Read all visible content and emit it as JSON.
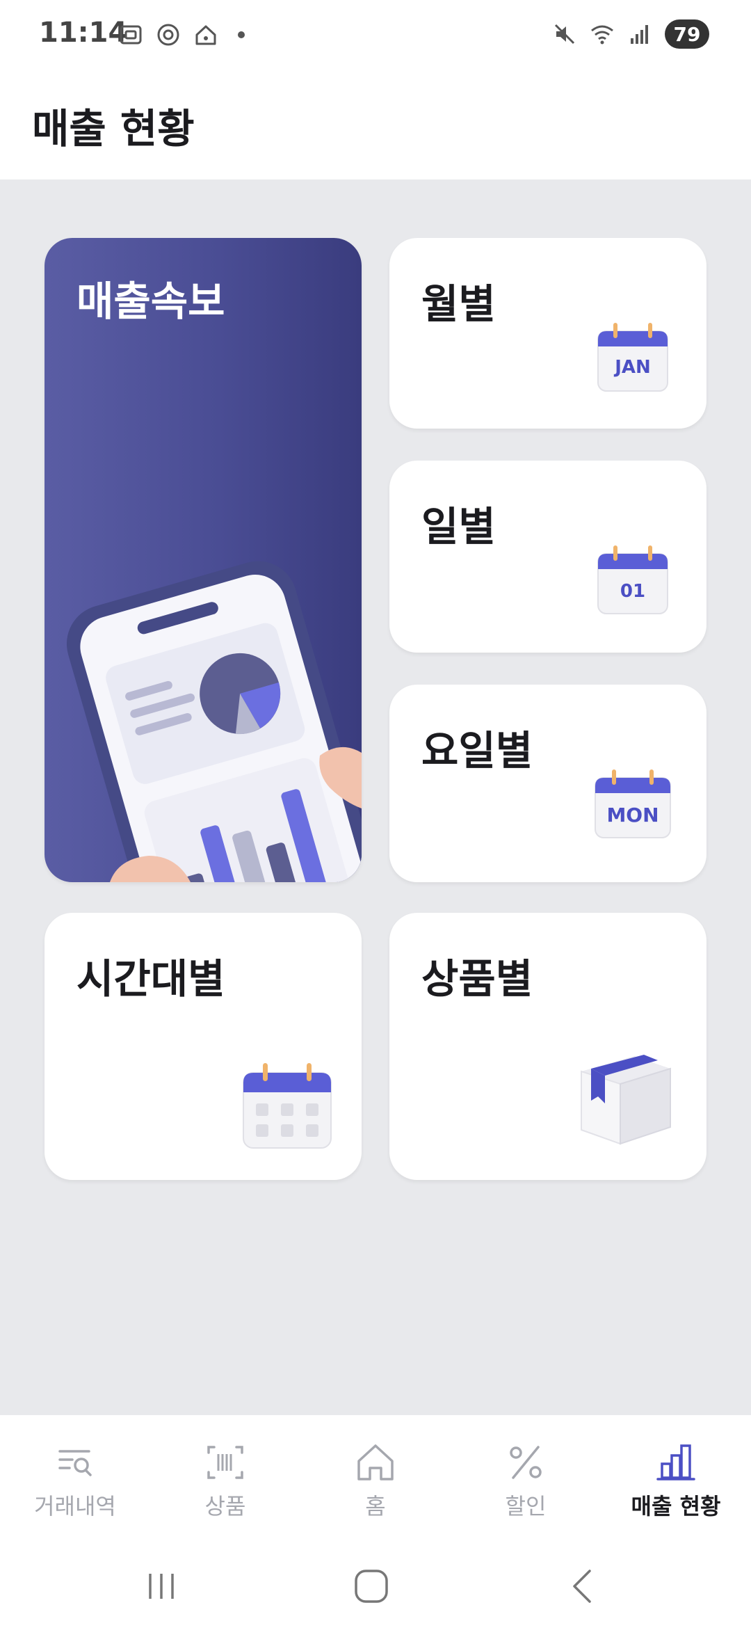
{
  "status_bar": {
    "time": "11:14",
    "battery": "79",
    "left_icons": [
      "screenshot-icon",
      "chrome-icon",
      "smart-home-icon",
      "notification-dot-icon"
    ],
    "right_icons": [
      "mute-icon",
      "wifi-icon",
      "signal-icon",
      "battery-icon"
    ]
  },
  "header": {
    "title": "매출 현황"
  },
  "cards": {
    "hero": {
      "label": "매출속보",
      "icon": "phone-chart-illustration"
    },
    "monthly": {
      "label": "월별",
      "icon_text": "JAN",
      "icon": "calendar-icon"
    },
    "daily": {
      "label": "일별",
      "icon_text": "01",
      "icon": "calendar-icon"
    },
    "weekday": {
      "label": "요일별",
      "icon_text": "MON",
      "icon": "calendar-icon"
    },
    "hourly": {
      "label": "시간대별",
      "icon": "calendar-grid-icon"
    },
    "product": {
      "label": "상품별",
      "icon": "box-icon"
    }
  },
  "bottom_nav": {
    "items": [
      {
        "label": "거래내역",
        "icon": "list-search-icon",
        "active": false
      },
      {
        "label": "상품",
        "icon": "barcode-icon",
        "active": false
      },
      {
        "label": "홈",
        "icon": "home-icon",
        "active": false
      },
      {
        "label": "할인",
        "icon": "percent-icon",
        "active": false
      },
      {
        "label": "매출 현황",
        "icon": "bar-chart-icon",
        "active": true
      }
    ]
  },
  "colors": {
    "accent": "#4b4fc4",
    "hero_gradient_start": "#5a5da4",
    "hero_gradient_end": "#3a3c7e",
    "background": "#e8e9ec",
    "inactive_nav": "#a5a7ae"
  }
}
